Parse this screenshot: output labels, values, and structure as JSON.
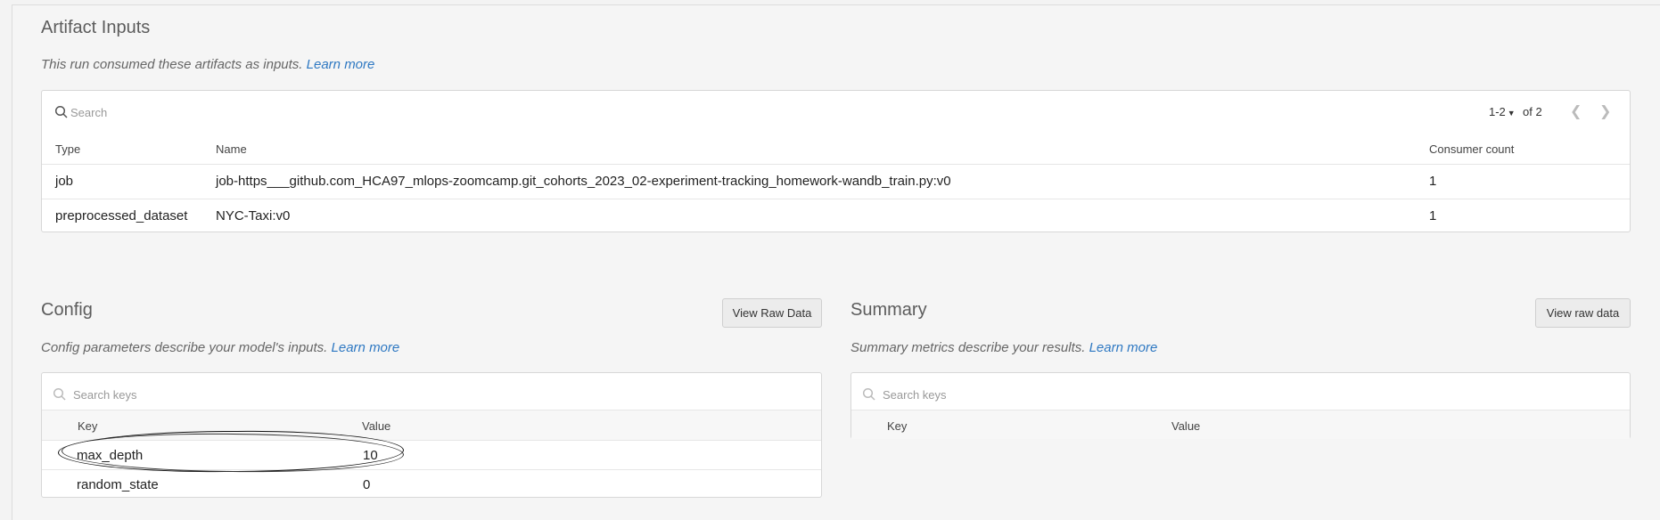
{
  "artifact_inputs": {
    "title": "Artifact Inputs",
    "description": "This run consumed these artifacts as inputs.",
    "learn_more": "Learn more",
    "search_placeholder": "Search",
    "pagination": {
      "range": "1-2",
      "of_label": "of 2"
    },
    "columns": [
      "Type",
      "Name",
      "Consumer count"
    ],
    "rows": [
      {
        "type": "job",
        "name": "job-https___github.com_HCA97_mlops-zoomcamp.git_cohorts_2023_02-experiment-tracking_homework-wandb_train.py:v0",
        "count": "1"
      },
      {
        "type": "preprocessed_dataset",
        "name": "NYC-Taxi:v0",
        "count": "1"
      }
    ]
  },
  "config": {
    "title": "Config",
    "button": "View Raw Data",
    "description": "Config parameters describe your model's inputs.",
    "learn_more": "Learn more",
    "search_placeholder": "Search keys",
    "columns": [
      "Key",
      "Value"
    ],
    "rows": [
      {
        "key": "max_depth",
        "value": "10"
      },
      {
        "key": "random_state",
        "value": "0"
      }
    ]
  },
  "summary": {
    "title": "Summary",
    "button": "View raw data",
    "description": "Summary metrics describe your results.",
    "learn_more": "Learn more",
    "search_placeholder": "Search keys",
    "columns": [
      "Key",
      "Value"
    ]
  },
  "colors": {
    "link": "#2e78c2",
    "annotation": "#111111"
  }
}
